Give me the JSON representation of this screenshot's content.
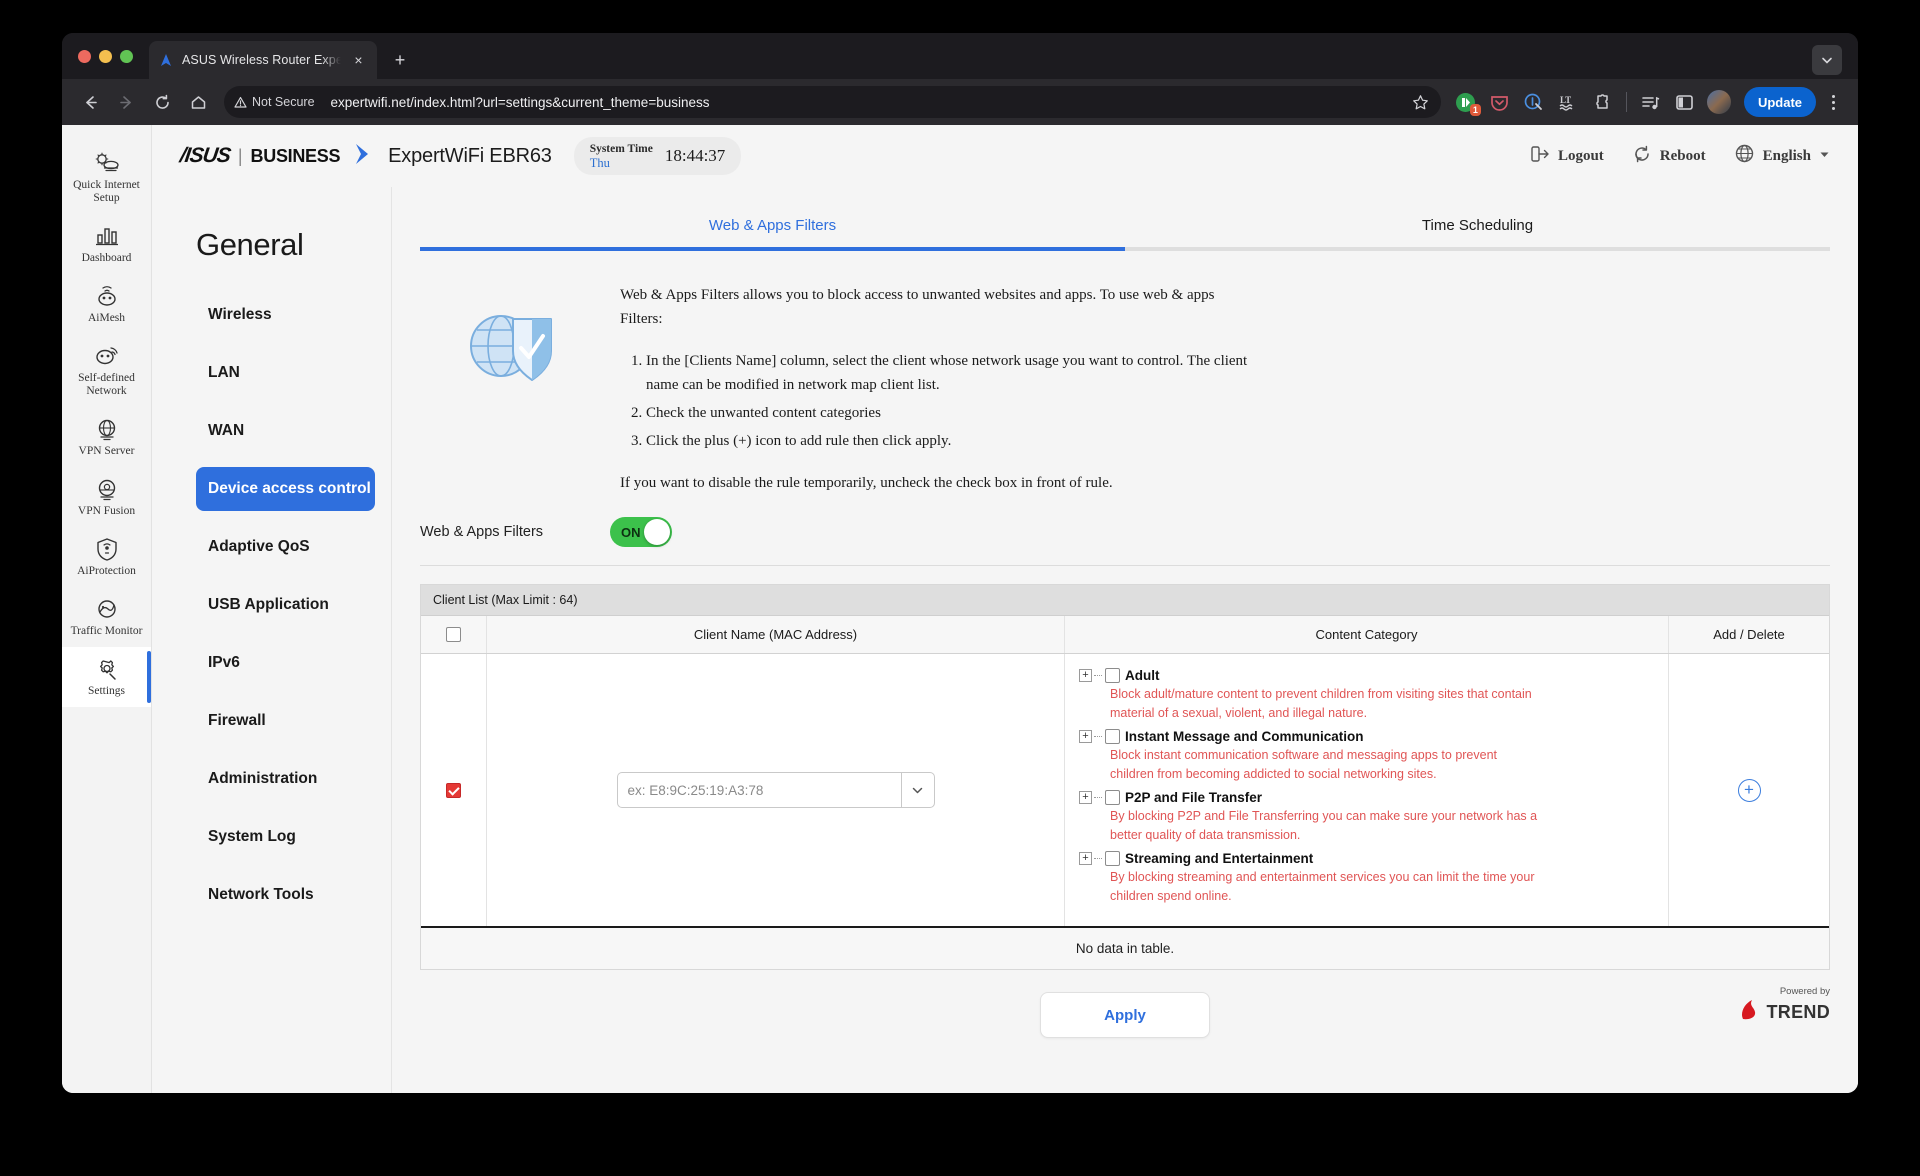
{
  "browser": {
    "tab": {
      "title": "ASUS Wireless Router Expert",
      "favicon": "asus-logo-icon",
      "close": "×"
    },
    "new_tab_label": "+",
    "nav": {
      "back": "←",
      "forward": "→",
      "reload": "⟳",
      "home": "⌂"
    },
    "url": {
      "security_label": "Not Secure",
      "address": "expertwifi.net/index.html?url=settings&current_theme=business"
    },
    "toolbar": {
      "bookmark": "bookmark-star-icon",
      "extension_badge": "1",
      "update_label": "Update"
    }
  },
  "rail": {
    "items": [
      {
        "label": "Quick Internet Setup",
        "icon": "quick-setup-icon",
        "active": false
      },
      {
        "label": "Dashboard",
        "icon": "dashboard-icon",
        "active": false
      },
      {
        "label": "AiMesh",
        "icon": "aimesh-icon",
        "active": false
      },
      {
        "label": "Self-defined Network",
        "icon": "self-defined-network-icon",
        "active": false
      },
      {
        "label": "VPN Server",
        "icon": "vpn-server-icon",
        "active": false
      },
      {
        "label": "VPN Fusion",
        "icon": "vpn-fusion-icon",
        "active": false
      },
      {
        "label": "AiProtection",
        "icon": "aiprotection-icon",
        "active": false
      },
      {
        "label": "Traffic Monitor",
        "icon": "traffic-monitor-icon",
        "active": false
      },
      {
        "label": "Settings",
        "icon": "settings-gear-icon",
        "active": true
      }
    ]
  },
  "header": {
    "asus": "/ISUS",
    "separator": "|",
    "business": "BUSINESS",
    "model": "ExpertWiFi EBR63",
    "system_time": {
      "label": "System Time",
      "day": "Thu",
      "clock": "18:44:37"
    },
    "logout": "Logout",
    "reboot": "Reboot",
    "language": "English"
  },
  "general": {
    "title": "General",
    "items": [
      {
        "label": "Wireless",
        "active": false
      },
      {
        "label": "LAN",
        "active": false
      },
      {
        "label": "WAN",
        "active": false
      },
      {
        "label": "Device access control",
        "active": true
      },
      {
        "label": "Adaptive QoS",
        "active": false
      },
      {
        "label": "USB Application",
        "active": false
      },
      {
        "label": "IPv6",
        "active": false
      },
      {
        "label": "Firewall",
        "active": false
      },
      {
        "label": "Administration",
        "active": false
      },
      {
        "label": "System Log",
        "active": false
      },
      {
        "label": "Network Tools",
        "active": false
      }
    ]
  },
  "main": {
    "tabs": [
      {
        "label": "Web & Apps Filters",
        "active": true
      },
      {
        "label": "Time Scheduling",
        "active": false
      }
    ],
    "description": {
      "intro": "Web & Apps Filters allows you to block access to unwanted websites and apps. To use web & apps Filters:",
      "steps": [
        "In the [Clients Name] column, select the client whose network usage you want to control. The client name can be modified in network map client list.",
        "Check the unwanted content categories",
        "Click the plus (+) icon to add rule then click apply."
      ],
      "note": "If you want to disable the rule temporarily, uncheck the check box in front of rule."
    },
    "toggle": {
      "label": "Web & Apps Filters",
      "state": "ON"
    },
    "table": {
      "caption": "Client List (Max Limit : 64)",
      "headers": {
        "check": "",
        "client": "Client Name (MAC Address)",
        "category": "Content Category",
        "add": "Add / Delete"
      },
      "row": {
        "checked": true,
        "client_placeholder": "ex: E8:9C:25:19:A3:78",
        "client_value": "",
        "add_icon": "+"
      },
      "categories": [
        {
          "name": "Adult",
          "checked": false,
          "desc": "Block adult/mature content to prevent children from visiting sites that contain material of a sexual, violent, and illegal nature."
        },
        {
          "name": "Instant Message and Communication",
          "checked": false,
          "desc": "Block instant communication software and messaging apps to prevent children from becoming addicted to social networking sites."
        },
        {
          "name": "P2P and File Transfer",
          "checked": false,
          "desc": "By blocking P2P and File Transferring you can make sure your network has a better quality of data transmission."
        },
        {
          "name": "Streaming and Entertainment",
          "checked": false,
          "desc": "By blocking streaming and entertainment services you can limit the time your children spend online."
        }
      ],
      "empty_text": "No data in table."
    },
    "apply_label": "Apply",
    "powered_by": "Powered by",
    "trend_name": "TREND"
  },
  "colors": {
    "accent_blue": "#2f6fdd",
    "toggle_green": "#3cc14b",
    "warning_red": "#e05555",
    "checkbox_red": "#e53935"
  }
}
